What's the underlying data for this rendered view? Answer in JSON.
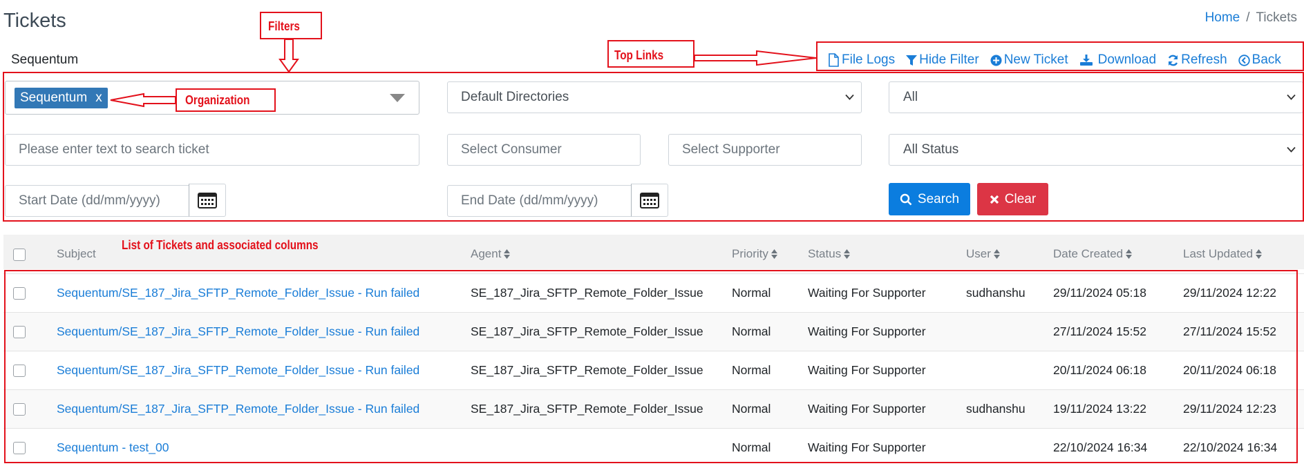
{
  "header": {
    "title": "Tickets"
  },
  "breadcrumb": {
    "home": "Home",
    "separator": "/",
    "current": "Tickets"
  },
  "organization_name": "Sequentum",
  "top_links": [
    {
      "label": "File Logs",
      "icon": "file-icon"
    },
    {
      "label": "Hide Filter",
      "icon": "filter-icon"
    },
    {
      "label": "New Ticket",
      "icon": "plus-circle-icon"
    },
    {
      "label": "Download",
      "icon": "download-icon"
    },
    {
      "label": "Refresh",
      "icon": "refresh-icon"
    },
    {
      "label": "Back",
      "icon": "back-circle-icon"
    }
  ],
  "filters": {
    "organization_tag": "Sequentum",
    "organization_tag_remove": "x",
    "directories": "Default Directories",
    "scope": "All",
    "search_placeholder": "Please enter text to search ticket",
    "consumer_placeholder": "Select Consumer",
    "supporter_placeholder": "Select Supporter",
    "status": "All Status",
    "start_date_placeholder": "Start Date (dd/mm/yyyy)",
    "end_date_placeholder": "End Date (dd/mm/yyyy)",
    "search_label": "Search",
    "clear_label": "Clear"
  },
  "table": {
    "columns": [
      "Subject",
      "Agent",
      "Priority",
      "Status",
      "User",
      "Date Created",
      "Last Updated"
    ],
    "rows": [
      {
        "subject": "Sequentum/SE_187_Jira_SFTP_Remote_Folder_Issue - Run failed",
        "agent": "SE_187_Jira_SFTP_Remote_Folder_Issue",
        "priority": "Normal",
        "status": "Waiting For Supporter",
        "user": "sudhanshu",
        "created": "29/11/2024 05:18",
        "updated": "29/11/2024 12:22"
      },
      {
        "subject": "Sequentum/SE_187_Jira_SFTP_Remote_Folder_Issue - Run failed",
        "agent": "SE_187_Jira_SFTP_Remote_Folder_Issue",
        "priority": "Normal",
        "status": "Waiting For Supporter",
        "user": "",
        "created": "27/11/2024 15:52",
        "updated": "27/11/2024 15:52"
      },
      {
        "subject": "Sequentum/SE_187_Jira_SFTP_Remote_Folder_Issue - Run failed",
        "agent": "SE_187_Jira_SFTP_Remote_Folder_Issue",
        "priority": "Normal",
        "status": "Waiting For Supporter",
        "user": "",
        "created": "20/11/2024 06:18",
        "updated": "20/11/2024 06:18"
      },
      {
        "subject": "Sequentum/SE_187_Jira_SFTP_Remote_Folder_Issue - Run failed",
        "agent": "SE_187_Jira_SFTP_Remote_Folder_Issue",
        "priority": "Normal",
        "status": "Waiting For Supporter",
        "user": "sudhanshu",
        "created": "19/11/2024 13:22",
        "updated": "29/11/2024 12:23"
      },
      {
        "subject": "Sequentum - test_00",
        "agent": "",
        "priority": "Normal",
        "status": "Waiting For Supporter",
        "user": "",
        "created": "22/10/2024 16:34",
        "updated": "22/10/2024 16:34"
      }
    ]
  },
  "annotations": {
    "filters": "Filters",
    "top_links": "Top Links",
    "organization": "Organization",
    "list": "List of Tickets and associated columns"
  },
  "colors": {
    "link": "#1a7dd7",
    "primary": "#0b7ddf",
    "danger": "#dc3545",
    "annotation": "#e3111b",
    "tag": "#3278b6"
  }
}
